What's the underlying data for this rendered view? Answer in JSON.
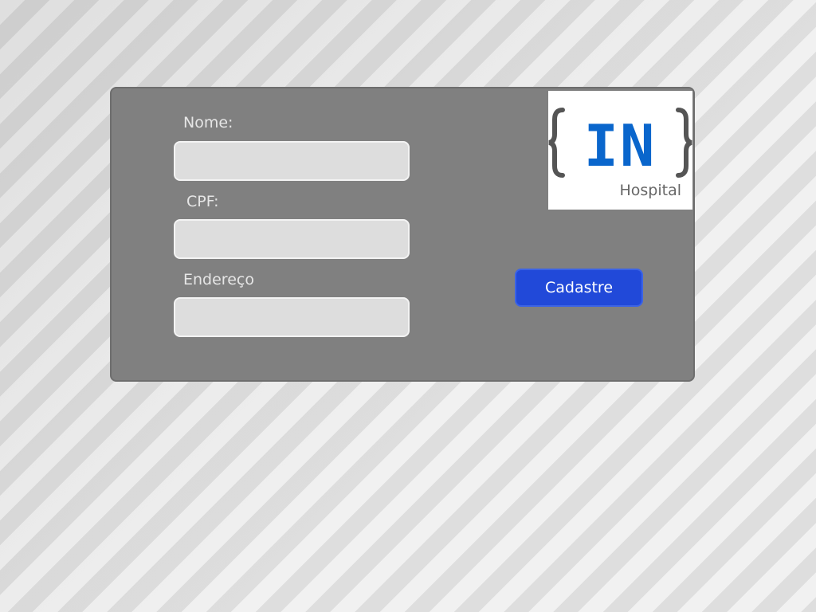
{
  "form": {
    "name_label": "Nome:",
    "name_value": "",
    "cpf_label": "CPF:",
    "cpf_value": "",
    "address_label": "Endereço",
    "address_value": "",
    "submit_label": "Cadastre"
  },
  "logo": {
    "wordmark": "IN",
    "caption": "Hospital",
    "brand_color": "#0a66cc",
    "brace_color": "#555555"
  },
  "colors": {
    "panel": "#808080",
    "button": "#2149d9"
  }
}
